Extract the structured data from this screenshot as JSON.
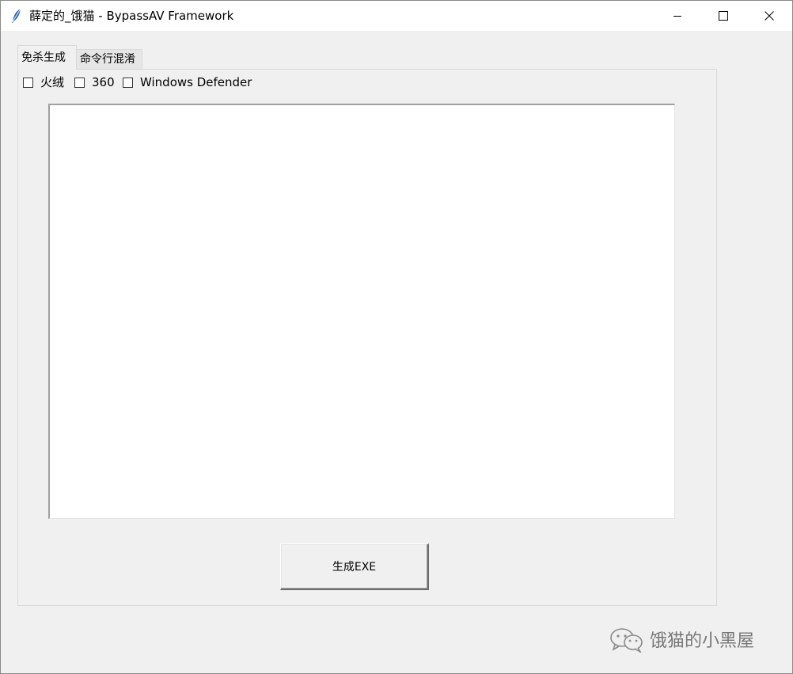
{
  "window": {
    "title": "薛定的_饿猫 - BypassAV Framework",
    "controls": {
      "minimize_icon": "minimize-icon",
      "maximize_icon": "maximize-icon",
      "close_icon": "close-icon"
    }
  },
  "tabs": [
    {
      "label": "免杀生成",
      "active": true
    },
    {
      "label": "命令行混淆",
      "active": false
    }
  ],
  "options": [
    {
      "label": "火绒",
      "checked": false
    },
    {
      "label": "360",
      "checked": false
    },
    {
      "label": "Windows Defender",
      "checked": false
    }
  ],
  "output": {
    "value": ""
  },
  "actions": {
    "generate_label": "生成EXE"
  },
  "watermark": {
    "text": "饿猫的小黑屋",
    "icon": "wechat-icon"
  }
}
